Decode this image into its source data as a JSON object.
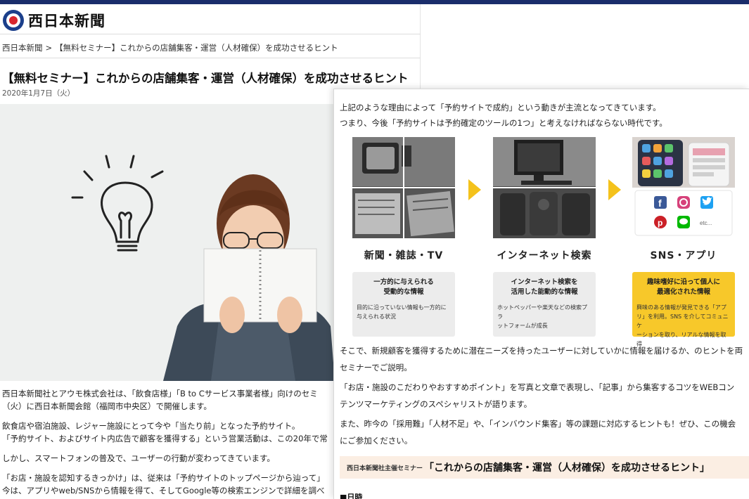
{
  "site": {
    "logo_text": "西日本新聞"
  },
  "breadcrumb": {
    "home": "西日本新聞",
    "separator": ">",
    "current": "【無料セミナー】これからの店舗集客・運営（人材確保）を成功させるヒント"
  },
  "article": {
    "title": "【無料セミナー】これからの店舗集客・運営（人材確保）を成功させるヒント",
    "date": "2020年1月7日（火）",
    "paragraphs": [
      "西日本新聞社とアウモ株式会社は、「飲食店様」「B to Cサービス事業者様」向けのセミ",
      "（火）に西日本新聞会館（福岡市中央区）で開催します。",
      "飲食店や宿泊施設、レジャー施設にとって今や「当たり前」となった予約サイト。",
      "「予約サイト、およびサイト内広告で顧客を獲得する」という営業活動は、この20年で常",
      "しかし、スマートフォンの普及で、ユーザーの行動が変わってきています。",
      "「お店・施設を認知するきっかけ」は、従来は「予約サイトのトップページから辿って」",
      "今は、アプリやweb/SNSから情報を得て、そしてGoogle等の検索エンジンで詳細を調べ"
    ]
  },
  "front": {
    "intro_lines": [
      "上記のような理由によって「予約サイトで成約」という動きが主流となってきています。",
      "つまり、今後「予約サイトは予約確定のツールの1つ」と考えなければならない時代です。"
    ],
    "media": [
      {
        "label": "新聞・雑誌・TV",
        "box_head": "一方的に与えられる\n受動的な情報",
        "box_body": "目的に沿っていない情報も一方的に\n与えられる状況"
      },
      {
        "label": "インターネット検索",
        "box_head": "インターネット検索を\n活用した能動的な情報",
        "box_body": "ホットペッパーや楽天などの検索プラ\nットフォームが成長"
      },
      {
        "label": "SNS・アプリ",
        "box_head": "趣味嗜好に沿って個人に\n最適化された情報",
        "box_body": "興味のある情報が発見できる「アプ\nリ」を利用。SNS を介してコミュニケ\nーションを取り、リアルな情報を取得"
      }
    ],
    "sns_etc": "etc...",
    "body_lines": [
      "そこで、新規顧客を獲得するために潜在ニーズを持ったユーザーに対していかに情報を届けるか、のヒントを両",
      "セミナーでご説明。",
      "「お店・施設のこだわりやおすすめポイント」を写真と文章で表現し、「記事」から集客するコツをWEBコン",
      "テンツマーケティングのスペシャリストが語ります。",
      "また、昨今の「採用難」「人材不足」や、「インバウンド集客」等の課題に対応するヒントも！ぜひ、この機会",
      "にご参加ください。"
    ],
    "banner_small": "西日本新聞社主催セミナー",
    "banner_big": "「これからの店舗集客・運営（人材確保）を成功させるヒント」",
    "schedule_label": "■日時"
  },
  "colors": {
    "topbar": "#1a2d6b",
    "accent_yellow": "#f4c21c",
    "box_gray": "#ececec",
    "box_yellow": "#f7c82a",
    "banner_bg": "#fbeee3"
  }
}
